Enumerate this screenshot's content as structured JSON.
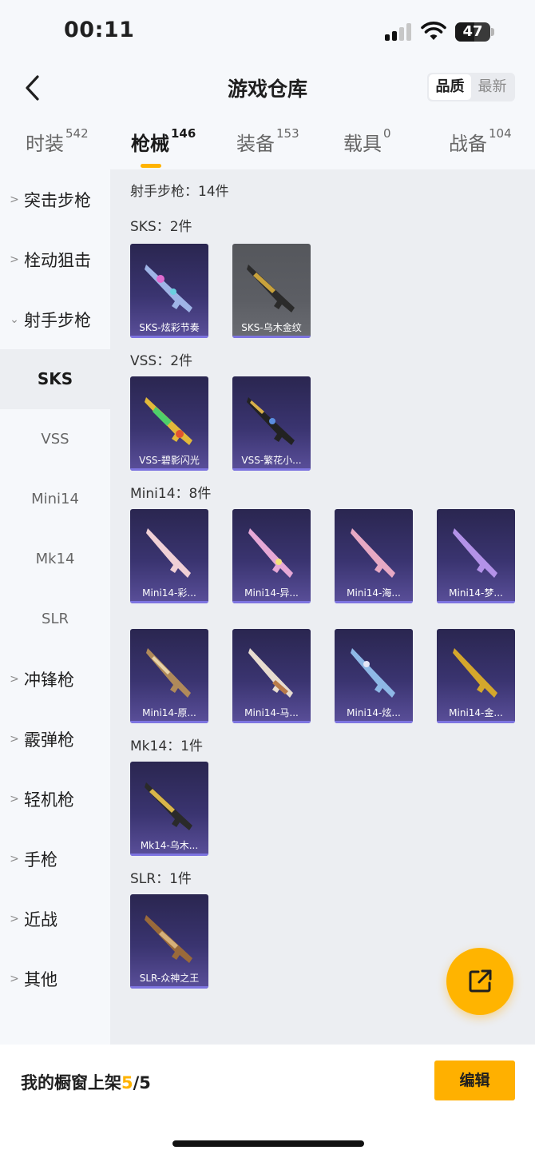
{
  "status": {
    "time": "00:11",
    "battery": "47"
  },
  "header": {
    "title": "游戏仓库",
    "sort_quality": "品质",
    "sort_newest": "最新"
  },
  "tabs": [
    {
      "label": "时装",
      "count": "542"
    },
    {
      "label": "枪械",
      "count": "146"
    },
    {
      "label": "装备",
      "count": "153"
    },
    {
      "label": "载具",
      "count": "0"
    },
    {
      "label": "战备",
      "count": "104"
    }
  ],
  "sidebar": {
    "cat_assault": "突击步枪",
    "cat_bolt": "栓动狙击",
    "cat_marksman": "射手步枪",
    "sub_sks": "SKS",
    "sub_vss": "VSS",
    "sub_mini14": "Mini14",
    "sub_mk14": "Mk14",
    "sub_slr": "SLR",
    "cat_smg": "冲锋枪",
    "cat_shotgun": "霰弹枪",
    "cat_lmg": "轻机枪",
    "cat_pistol": "手枪",
    "cat_melee": "近战",
    "cat_other": "其他"
  },
  "content": {
    "total": "射手步枪：14件",
    "sks_title": "SKS：2件",
    "sks_items": [
      "SKS-炫彩节奏",
      "SKS-乌木金纹"
    ],
    "vss_title": "VSS：2件",
    "vss_items": [
      "VSS-碧影闪光",
      "VSS-繁花小..."
    ],
    "mini14_title": "Mini14：8件",
    "mini14_items": [
      "Mini14-彩...",
      "Mini14-异...",
      "Mini14-海...",
      "Mini14-梦...",
      "Mini14-原...",
      "Mini14-马...",
      "Mini14-炫...",
      "Mini14-金..."
    ],
    "mk14_title": "Mk14：1件",
    "mk14_items": [
      "Mk14-乌木..."
    ],
    "slr_title": "SLR：1件",
    "slr_items": [
      "SLR-众神之王"
    ]
  },
  "bottom": {
    "shelf_label": "我的橱窗上架",
    "shelf_used": "5",
    "shelf_total": "/5",
    "edit_label": "编辑"
  },
  "icons": {
    "back": "chevron-left-icon",
    "share": "share-external-icon",
    "expand_closed": "chevron-right-icon",
    "expand_open": "chevron-down-icon"
  },
  "colors": {
    "accent": "#ffb000",
    "card_bg": "#2a2650",
    "card_grey": "#55575c",
    "card_line": "#7d74e0"
  }
}
